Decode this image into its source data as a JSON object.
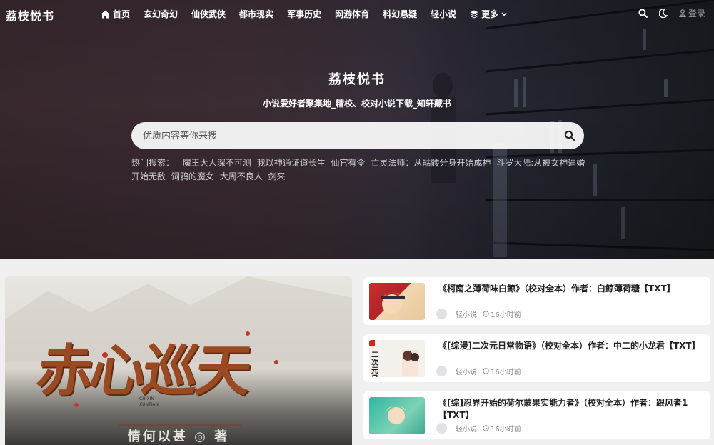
{
  "site": {
    "logo": "荔枝悦书"
  },
  "nav": {
    "items": [
      {
        "label": "首页",
        "icon": "home-icon"
      },
      {
        "label": "玄幻奇幻"
      },
      {
        "label": "仙侠武侠"
      },
      {
        "label": "都市现实"
      },
      {
        "label": "军事历史"
      },
      {
        "label": "网游体育"
      },
      {
        "label": "科幻悬疑"
      },
      {
        "label": "轻小说"
      },
      {
        "label": "更多",
        "icon": "layers-icon"
      }
    ],
    "login_label": "登录"
  },
  "hero": {
    "title": "荔枝悦书",
    "subtitle": "小说爱好者聚集地_精校、校对小说下载_知轩藏书",
    "search_placeholder": "优质内容等你来搜",
    "hot_label": "热门搜索：",
    "hot_terms": [
      "魔王大人深不可测",
      "我以神通证道长生",
      "仙官有令",
      "亡灵法师：从骷髅分身开始成神",
      "斗罗大陆:从被女神逼婚开始无敌",
      "饲鸦的魔女",
      "大周不良人",
      "剑来"
    ]
  },
  "featured": {
    "cover_title": "赤心巡天",
    "cover_pinyin_1": "CHIXIN",
    "cover_pinyin_2": "XUNTIAN",
    "cover_author": "情何以甚 ◎ 著"
  },
  "posts": [
    {
      "title": "《柯南之薄荷味白鲸》（校对全本）作者：白鲸薄荷糖【TXT】",
      "category": "轻小说",
      "time": "16小时前"
    },
    {
      "title": "《[综漫]二次元日常物语》（校对全本）作者：中二的小龙君【TXT】",
      "category": "轻小说",
      "time": "16小时前",
      "thumb_text": "二次元日"
    },
    {
      "title": "《[综]忍界开始的荷尔蒙果实能力者》（校对全本）作者：跟风者1【TXT】",
      "category": "轻小说",
      "time": "16小时前"
    }
  ],
  "colors": {
    "accent": "#9a4a22",
    "hero_bg": "#3a2a30"
  }
}
